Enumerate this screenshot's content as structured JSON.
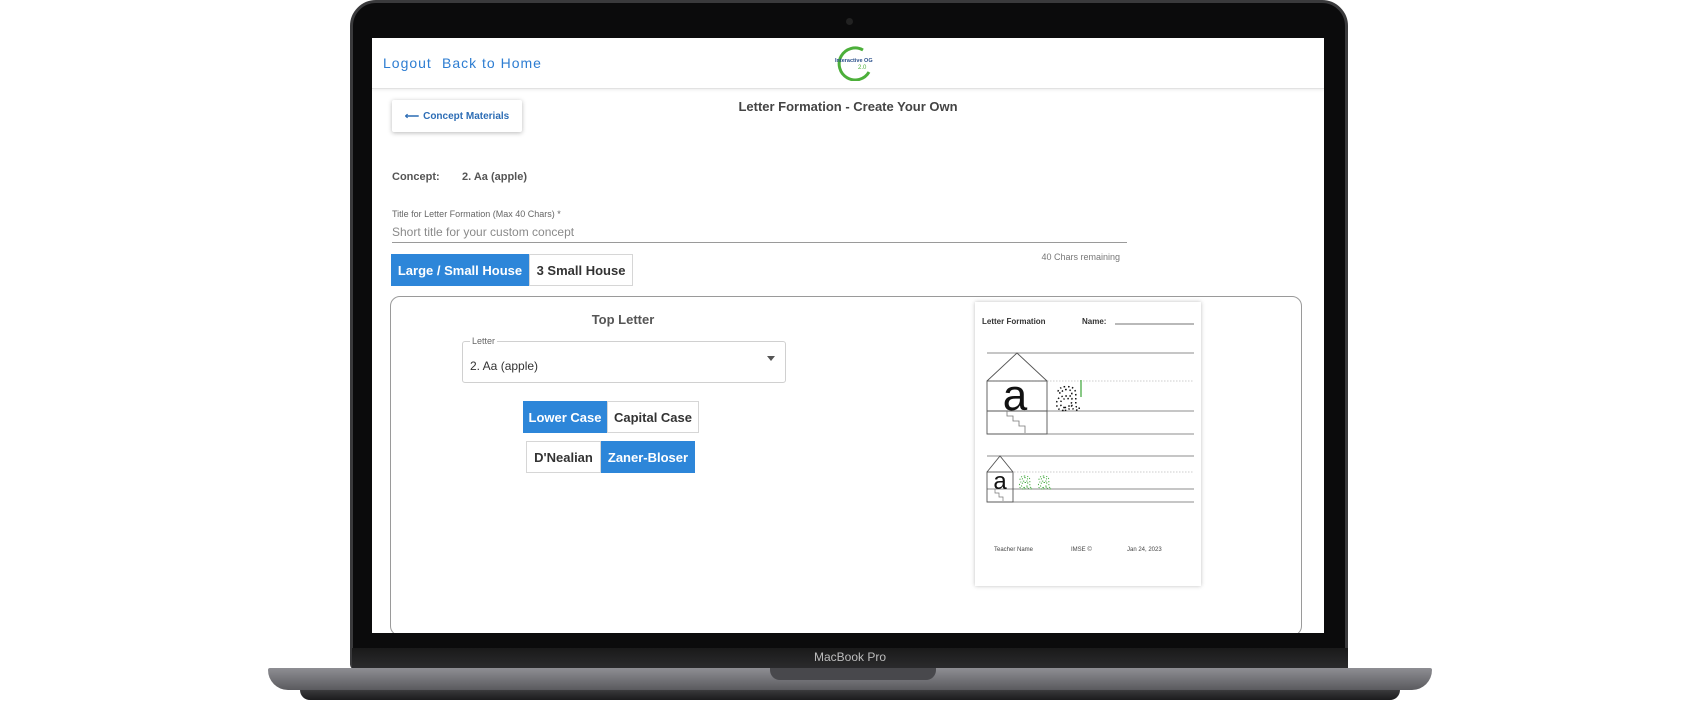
{
  "device": {
    "brand_label": "MacBook Pro"
  },
  "nav": {
    "logout": "Logout",
    "back_home": "Back to Home"
  },
  "logo": {
    "line1": "Interactive OG",
    "line2": "2.0"
  },
  "header": {
    "back_button": "Concept Materials",
    "title": "Letter Formation - Create Your Own"
  },
  "concept": {
    "label": "Concept:",
    "value": "2. Aa (apple)"
  },
  "title_field": {
    "label": "Title for Letter Formation (Max 40 Chars) *",
    "placeholder": "Short title for your custom concept",
    "value": "",
    "remaining": "40 Chars remaining"
  },
  "house_toggle": {
    "options": [
      "Large / Small House",
      "3 Small House"
    ],
    "selected": 0
  },
  "top_letter": {
    "heading": "Top Letter",
    "select_label": "Letter",
    "select_value": "2. Aa (apple)",
    "case_options": [
      "Lower Case",
      "Capital Case"
    ],
    "case_selected": 0,
    "font_options": [
      "D'Nealian",
      "Zaner-Bloser"
    ],
    "font_selected": 1
  },
  "preview": {
    "title": "Letter Formation",
    "name_label": "Name:",
    "teacher": "Teacher Name",
    "imse": "IMSE ©",
    "date": "Jan 24, 2023",
    "letter": "a"
  },
  "colors": {
    "accent": "#2d86d9",
    "link": "#2d7dd2",
    "trace_green": "#3aa535"
  }
}
